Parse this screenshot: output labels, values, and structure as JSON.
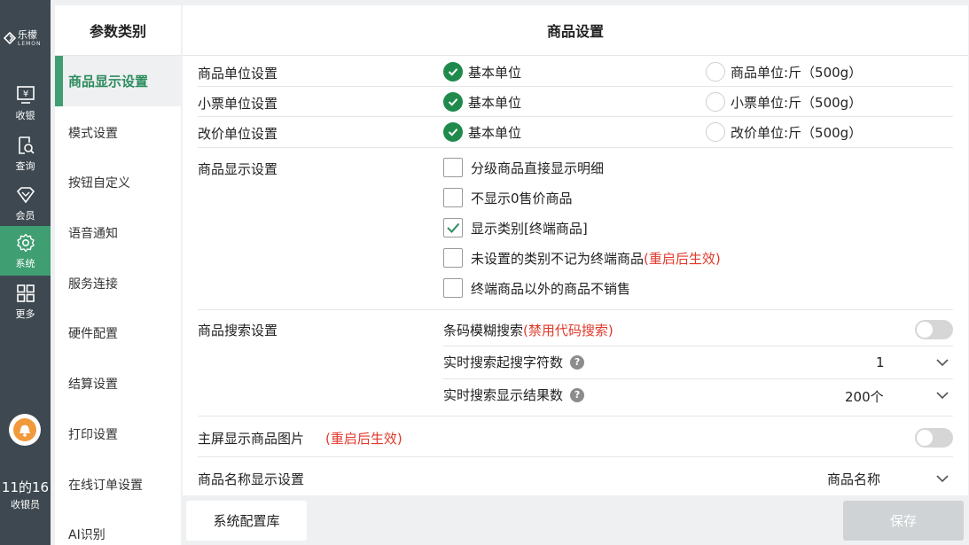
{
  "app": {
    "logo_cn": "乐檬",
    "logo_en": "LEMON"
  },
  "nav": {
    "items": [
      {
        "label": "收银",
        "icon": "cashier-icon"
      },
      {
        "label": "查询",
        "icon": "query-icon"
      },
      {
        "label": "会员",
        "icon": "member-icon"
      },
      {
        "label": "系统",
        "icon": "gear-icon"
      },
      {
        "label": "更多",
        "icon": "grid-icon"
      }
    ],
    "active": 3,
    "clock": "11的16",
    "role": "收银员"
  },
  "categories": {
    "title": "参数类别",
    "items": [
      "商品显示设置",
      "模式设置",
      "按钮自定义",
      "语音通知",
      "服务连接",
      "硬件配置",
      "结算设置",
      "打印设置",
      "在线订单设置",
      "AI识别"
    ],
    "active": 0
  },
  "main": {
    "title": "商品设置",
    "unit_rows": [
      {
        "label": "商品单位设置",
        "opt1": "基本单位",
        "opt2": "商品单位:斤（500g）"
      },
      {
        "label": "小票单位设置",
        "opt1": "基本单位",
        "opt2": "小票单位:斤（500g）"
      },
      {
        "label": "改价单位设置",
        "opt1": "基本单位",
        "opt2": "改价单位:斤（500g）"
      }
    ],
    "display": {
      "label": "商品显示设置",
      "options": [
        {
          "text": "分级商品直接显示明细",
          "note": "",
          "checked": false
        },
        {
          "text": "不显示0售价商品",
          "note": "",
          "checked": false
        },
        {
          "text": "显示类别[终端商品]",
          "note": "",
          "checked": true
        },
        {
          "text": "未设置的类别不记为终端商品",
          "note": "(重启后生效)",
          "checked": false
        },
        {
          "text": "终端商品以外的商品不销售",
          "note": "",
          "checked": false
        }
      ]
    },
    "search": {
      "label": "商品搜索设置",
      "fuzzy_label": "条码模糊搜索",
      "fuzzy_note": "(禁用代码搜索)",
      "min_chars_label": "实时搜索起搜字符数",
      "min_chars_value": "1",
      "result_label": "实时搜索显示结果数",
      "result_value": "200个"
    },
    "image": {
      "label": "主屏显示商品图片",
      "note": "(重启后生效)"
    },
    "name_display": {
      "label": "商品名称显示设置",
      "value": "商品名称"
    }
  },
  "buttons": {
    "config_lib": "系统配置库",
    "save": "保存"
  },
  "colors": {
    "accent": "#3f9e72",
    "nav_bg": "#3d4850",
    "check": "#1f8a4c",
    "warn": "#e0392b"
  }
}
